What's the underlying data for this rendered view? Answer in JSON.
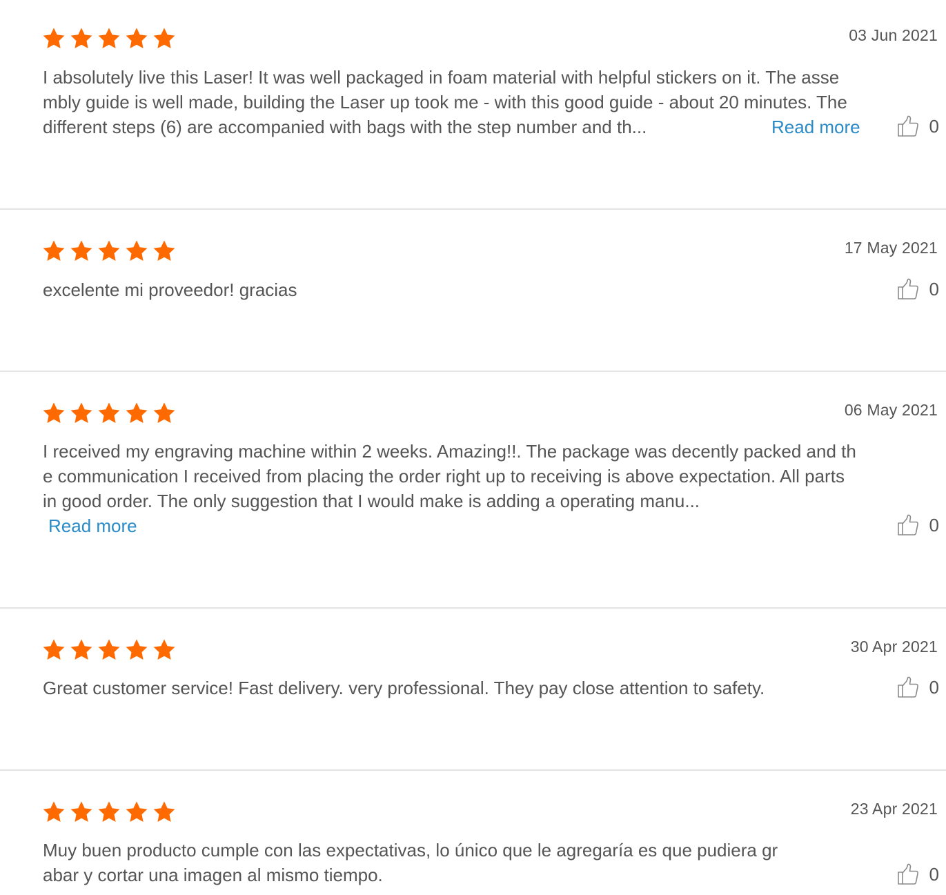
{
  "colors": {
    "star": "#ff6a00",
    "link": "#2a8bc7",
    "text": "#555555",
    "divider": "#e3e3e3"
  },
  "reviews": [
    {
      "rating": 5,
      "date": "03 Jun 2021",
      "lines": [
        "I absolutely live this Laser! It was well packaged in foam material with helpful stickers on it. The asse",
        "mbly guide is well made, building the Laser up took me - with this good guide - about 20 minutes. The",
        "different steps (6) are accompanied with bags with the step number and th..."
      ],
      "read_more": "Read more",
      "likes": "0"
    },
    {
      "rating": 5,
      "date": "17 May 2021",
      "lines": [
        "excelente mi proveedor! gracias"
      ],
      "likes": "0"
    },
    {
      "rating": 5,
      "date": "06 May 2021",
      "lines": [
        "I received my engraving machine within 2 weeks. Amazing!!. The package was decently packed and th",
        "e communication I received from placing the order right up to receiving is above expectation. All parts",
        "in good order. The only suggestion that I would make is adding a operating manu..."
      ],
      "read_more": "Read more",
      "likes": "0"
    },
    {
      "rating": 5,
      "date": "30 Apr 2021",
      "lines": [
        "Great customer service! Fast delivery. very professional. They pay close attention to safety."
      ],
      "likes": "0"
    },
    {
      "rating": 5,
      "date": "23 Apr 2021",
      "lines": [
        "Muy buen producto cumple con las expectativas, lo único que le agregaría es que pudiera gr",
        "abar y cortar una imagen al mismo tiempo."
      ],
      "likes": "0"
    }
  ],
  "icons": {
    "star": "star-icon",
    "like": "thumbs-up-icon"
  }
}
